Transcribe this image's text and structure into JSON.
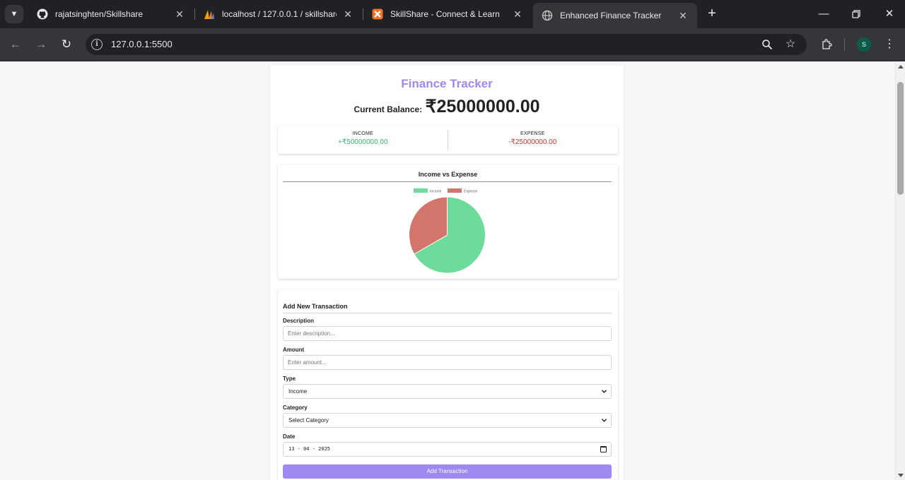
{
  "browser": {
    "tabs": [
      {
        "title": "rajatsinghten/Skillshare",
        "icon": "github-icon"
      },
      {
        "title": "localhost / 127.0.0.1 / skillshare | p",
        "icon": "phpmyadmin-icon"
      },
      {
        "title": "SkillShare - Connect & Learn",
        "icon": "xampp-icon"
      },
      {
        "title": "Enhanced Finance Tracker",
        "icon": "globe-icon"
      }
    ],
    "url": "127.0.0.1:5500",
    "profile_initial": "S"
  },
  "app": {
    "title": "Finance Tracker",
    "balance_label": "Current Balance:",
    "balance_value": "₹25000000.00"
  },
  "summary": {
    "income_label": "INCOME",
    "income_value": "+₹50000000.00",
    "expense_label": "EXPENSE",
    "expense_value": "-₹25000000.00"
  },
  "colors": {
    "accent": "#9d89ef",
    "income": "#3cb371",
    "expense": "#c0392b",
    "pie_income": "#6ddc9b",
    "pie_expense": "#d4756b"
  },
  "chart_data": {
    "type": "pie",
    "title": "Income vs Expense",
    "categories": [
      "Income",
      "Expense"
    ],
    "values": [
      50000000,
      25000000
    ],
    "legend": "top"
  },
  "form": {
    "title": "Add New Transaction",
    "description_label": "Description",
    "description_placeholder": "Enter description...",
    "amount_label": "Amount",
    "amount_placeholder": "Enter amount...",
    "type_label": "Type",
    "type_value": "Income",
    "category_label": "Category",
    "category_value": "Select Category",
    "date_label": "Date",
    "date_value": "13 - 04 - 2025",
    "submit_label": "Add Transaction"
  }
}
